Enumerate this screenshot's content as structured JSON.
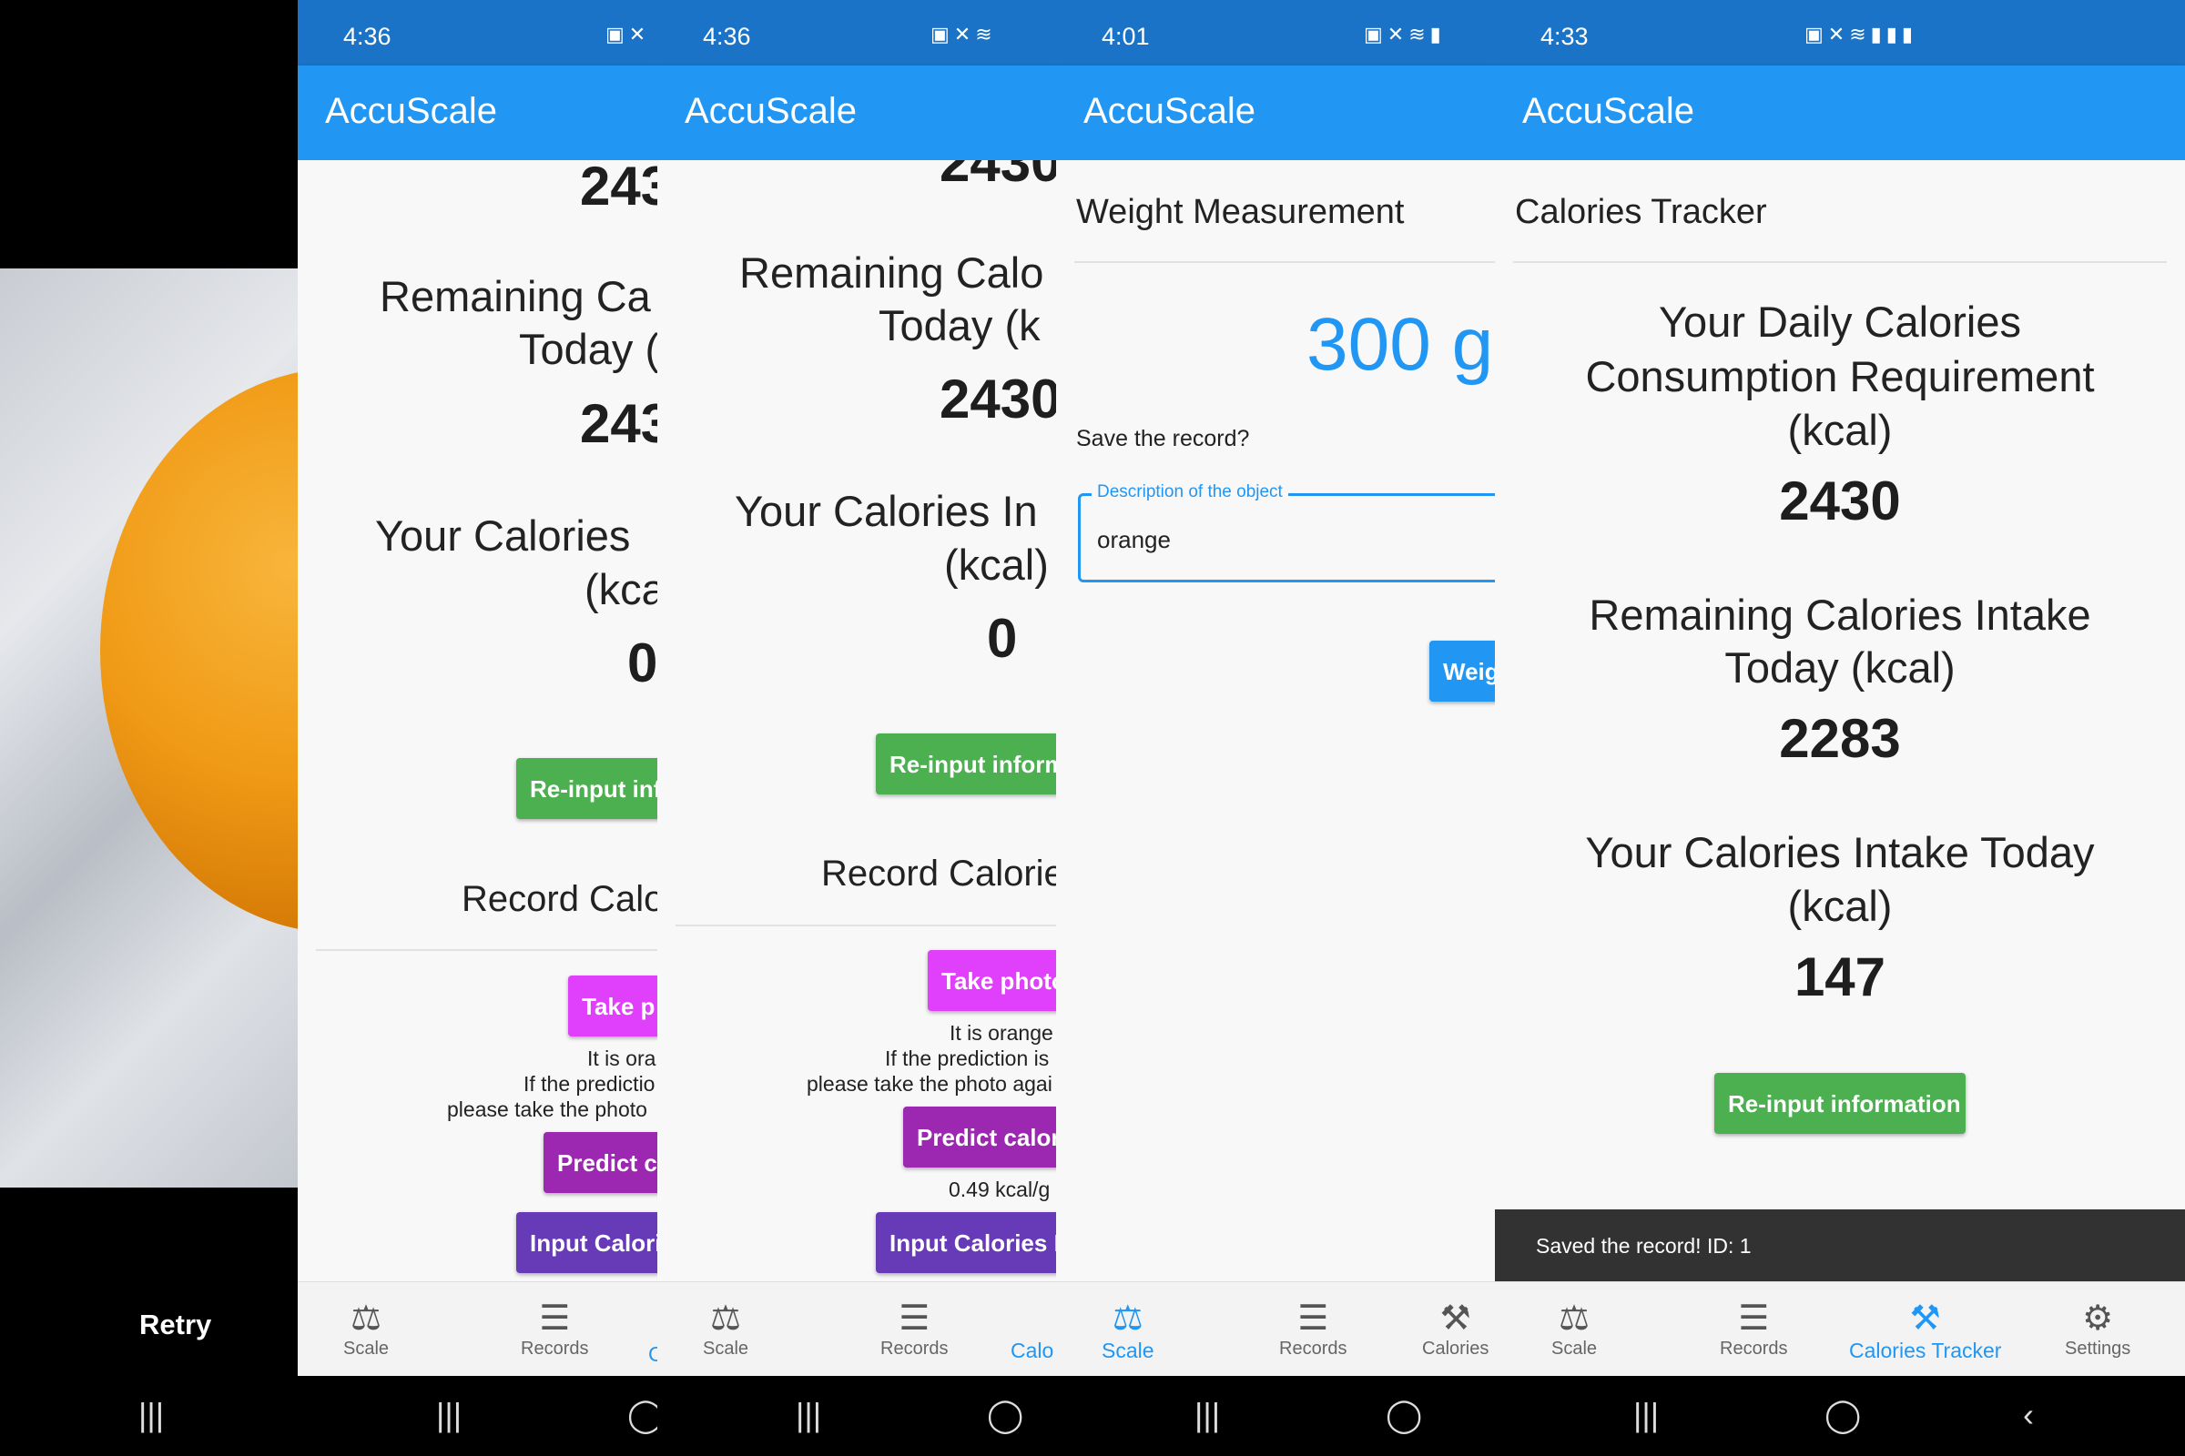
{
  "camera": {
    "retry_label": "Retry"
  },
  "status_times": [
    "4:36",
    "4:36",
    "4:01",
    "4:33"
  ],
  "app_title": "AccuScale",
  "nav": {
    "scale": "Scale",
    "records": "Records",
    "calories_tracker": "Calories Tracker",
    "calories_cut": "Calories",
    "calories_cut2": "Calo",
    "settings": "Settings"
  },
  "panel2": {
    "num_top": "243",
    "remaining_l1": "Remaining Ca",
    "remaining_l2": "Today (",
    "remaining_val": "243",
    "intake_l1": "Your Calories",
    "intake_l2": "(kca",
    "intake_val": "0",
    "reinput": "Re-input inf",
    "record_header": "Record Calo",
    "take_photo": "Take p",
    "pred_l1": "It is ora",
    "pred_l2": "If the predictio",
    "pred_l3": "please take the photo",
    "predict": "Predict c",
    "input_cal": "Input Calori",
    "nav_calories_cut": "C"
  },
  "panel3": {
    "num_top": "2430",
    "remaining_l1": "Remaining Calo",
    "remaining_l2": "Today (k",
    "remaining_val": "2430",
    "intake_l1": "Your Calories In",
    "intake_l2": "(kcal)",
    "intake_val": "0",
    "reinput": "Re-input inform",
    "record_header": "Record Calorie",
    "take_photo": "Take photo",
    "pred_l1": "It is orange",
    "pred_l2": "If the prediction is",
    "pred_l3": "please take the photo agai",
    "predict": "Predict calor",
    "kcal_per_g": "0.49 kcal/g",
    "input_cal": "Input Calories I"
  },
  "panel4": {
    "header": "Weight Measurement",
    "weight": "300 g",
    "save_prompt": "Save the record?",
    "field_label": "Description of the object",
    "field_value": "orange",
    "weigh_btn": "Weig"
  },
  "panel5": {
    "header": "Calories Tracker",
    "daily_l1": "Your Daily Calories",
    "daily_l2": "Consumption Requirement",
    "daily_l3": "(kcal)",
    "daily_val": "2430",
    "remaining_l1": "Remaining Calories Intake",
    "remaining_l2": "Today (kcal)",
    "remaining_val": "2283",
    "intake_l1": "Your Calories Intake Today",
    "intake_l2": "(kcal)",
    "intake_val": "147",
    "reinput": "Re-input information",
    "snackbar": "Saved the record! ID: 1"
  },
  "colors": {
    "app_bar": "#2196f3",
    "status_bar": "#1a73c7",
    "green": "#4caf50",
    "magenta": "#e040fb",
    "purple": "#9c27b0",
    "deep_purple": "#673ab7"
  }
}
